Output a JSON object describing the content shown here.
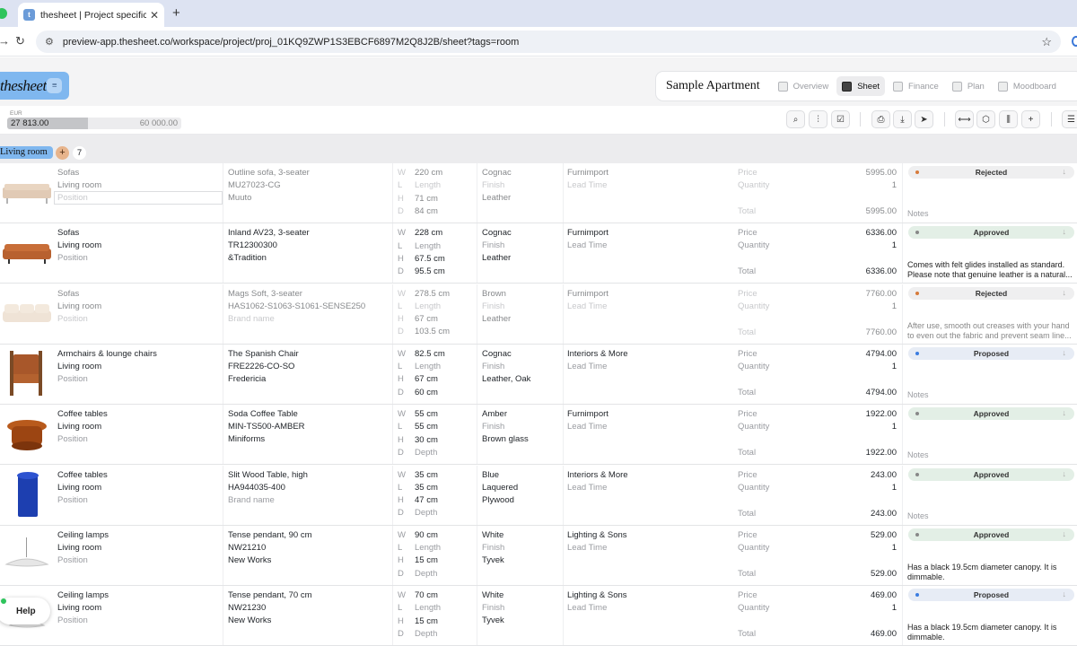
{
  "browser": {
    "tab_title": "thesheet | Project specificatio",
    "url": "preview-app.thesheet.co/workspace/project/proj_01KQ9ZWP1S3EBCF6897M2Q8J2B/sheet?tags=room"
  },
  "app": {
    "logo": "thesheet",
    "project_name": "Sample Apartment",
    "nav": [
      {
        "label": "Overview",
        "icon": "overview-icon",
        "active": false
      },
      {
        "label": "Sheet",
        "icon": "sheet-icon",
        "active": true
      },
      {
        "label": "Finance",
        "icon": "finance-icon",
        "active": false
      },
      {
        "label": "Plan",
        "icon": "plan-icon",
        "active": false
      },
      {
        "label": "Moodboard",
        "icon": "moodboard-icon",
        "active": false
      }
    ]
  },
  "budget": {
    "currency": "EUR",
    "spent": "27 813.00",
    "total": "60 000.00",
    "spent_fraction": 0.4636
  },
  "group": {
    "label": "Living room",
    "add": "+",
    "count": "7"
  },
  "labels": {
    "w": "W",
    "l": "L",
    "h": "H",
    "d": "D",
    "price": "Price",
    "quantity": "Quantity",
    "total": "Total",
    "lead_time": "Lead Time"
  },
  "rows": [
    {
      "category": "Sofas",
      "room": "Living room",
      "position": "Position",
      "name": "Outline sofa, 3-seater",
      "code": "MU27023-CG",
      "brand": "Muuto",
      "w": "220 cm",
      "l": "Length",
      "h": "71 cm",
      "d": "84 cm",
      "color": "Cognac",
      "finish": "Finish",
      "material": "Leather",
      "supplier": "Furnimport",
      "lead": "Lead Time",
      "price": "5995.00",
      "qty": "1",
      "total": "5995.00",
      "status": "Rejected",
      "status_kind": "rej",
      "note": "Notes",
      "note_empty": true,
      "faded": true
    },
    {
      "category": "Sofas",
      "room": "Living room",
      "position": "Position",
      "name": "Inland AV23, 3-seater",
      "code": "TR12300300",
      "brand": "&Tradition",
      "w": "228 cm",
      "l": "Length",
      "h": "67.5 cm",
      "d": "95.5 cm",
      "color": "Cognac",
      "finish": "Finish",
      "material": "Leather",
      "supplier": "Furnimport",
      "lead": "Lead Time",
      "price": "6336.00",
      "qty": "1",
      "total": "6336.00",
      "status": "Approved",
      "status_kind": "app",
      "note": "Comes with felt glides installed as standard. Please note that genuine leather is a natural...",
      "note_empty": false,
      "faded": false
    },
    {
      "category": "Sofas",
      "room": "Living room",
      "position": "Position",
      "name": "Mags Soft, 3-seater",
      "code": "HAS1062-S1063-S1061-SENSE250",
      "brand": "Brand name",
      "w": "278.5 cm",
      "l": "Length",
      "h": "67 cm",
      "d": "103.5 cm",
      "color": "Brown",
      "finish": "Finish",
      "material": "Leather",
      "supplier": "Furnimport",
      "lead": "Lead Time",
      "price": "7760.00",
      "qty": "1",
      "total": "7760.00",
      "status": "Rejected",
      "status_kind": "rej",
      "note": "After use, smooth out creases with your hand to even out the fabric and prevent seam line...",
      "note_empty": false,
      "faded": true
    },
    {
      "category": "Armchairs & lounge chairs",
      "room": "Living room",
      "position": "Position",
      "name": "The Spanish Chair",
      "code": "FRE2226-CO-SO",
      "brand": "Fredericia",
      "w": "82.5 cm",
      "l": "Length",
      "h": "67 cm",
      "d": "60 cm",
      "color": "Cognac",
      "finish": "Finish",
      "material": "Leather, Oak",
      "supplier": "Interiors & More",
      "lead": "Lead Time",
      "price": "4794.00",
      "qty": "1",
      "total": "4794.00",
      "status": "Proposed",
      "status_kind": "pro",
      "note": "Notes",
      "note_empty": true,
      "faded": false
    },
    {
      "category": "Coffee tables",
      "room": "Living room",
      "position": "Position",
      "name": "Soda Coffee Table",
      "code": "MIN-TS500-AMBER",
      "brand": "Miniforms",
      "w": "55 cm",
      "l": "55 cm",
      "h": "30 cm",
      "d": "Depth",
      "color": "Amber",
      "finish": "Finish",
      "material": "Brown glass",
      "supplier": "Furnimport",
      "lead": "Lead Time",
      "price": "1922.00",
      "qty": "1",
      "total": "1922.00",
      "status": "Approved",
      "status_kind": "app",
      "note": "Notes",
      "note_empty": true,
      "faded": false
    },
    {
      "category": "Coffee tables",
      "room": "Living room",
      "position": "Position",
      "name": "Slit Wood Table, high",
      "code": "HA944035-400",
      "brand": "Brand name",
      "w": "35 cm",
      "l": "35 cm",
      "h": "47 cm",
      "d": "Depth",
      "color": "Blue",
      "finish": "Laquered",
      "material": "Plywood",
      "supplier": "Interiors & More",
      "lead": "Lead Time",
      "price": "243.00",
      "qty": "1",
      "total": "243.00",
      "status": "Approved",
      "status_kind": "app",
      "note": "Notes",
      "note_empty": true,
      "faded": false
    },
    {
      "category": "Ceiling lamps",
      "room": "Living room",
      "position": "Position",
      "name": "Tense pendant, 90 cm",
      "code": "NW21210",
      "brand": "New Works",
      "w": "90 cm",
      "l": "Length",
      "h": "15 cm",
      "d": "Depth",
      "color": "White",
      "finish": "Finish",
      "material": "Tyvek",
      "supplier": "Lighting & Sons",
      "lead": "Lead Time",
      "price": "529.00",
      "qty": "1",
      "total": "529.00",
      "status": "Approved",
      "status_kind": "app",
      "note": "Has a black 19.5cm diameter canopy. It is dimmable.",
      "note_empty": false,
      "faded": false
    },
    {
      "category": "Ceiling lamps",
      "room": "Living room",
      "position": "Position",
      "name": "Tense pendant, 70 cm",
      "code": "NW21230",
      "brand": "New Works",
      "w": "70 cm",
      "l": "Length",
      "h": "15 cm",
      "d": "Depth",
      "color": "White",
      "finish": "Finish",
      "material": "Tyvek",
      "supplier": "Lighting & Sons",
      "lead": "Lead Time",
      "price": "469.00",
      "qty": "1",
      "total": "469.00",
      "status": "Proposed",
      "status_kind": "pro",
      "note": "Has a black 19.5cm diameter canopy. It is dimmable.",
      "note_empty": false,
      "faded": false
    }
  ],
  "help": {
    "label": "Help"
  }
}
